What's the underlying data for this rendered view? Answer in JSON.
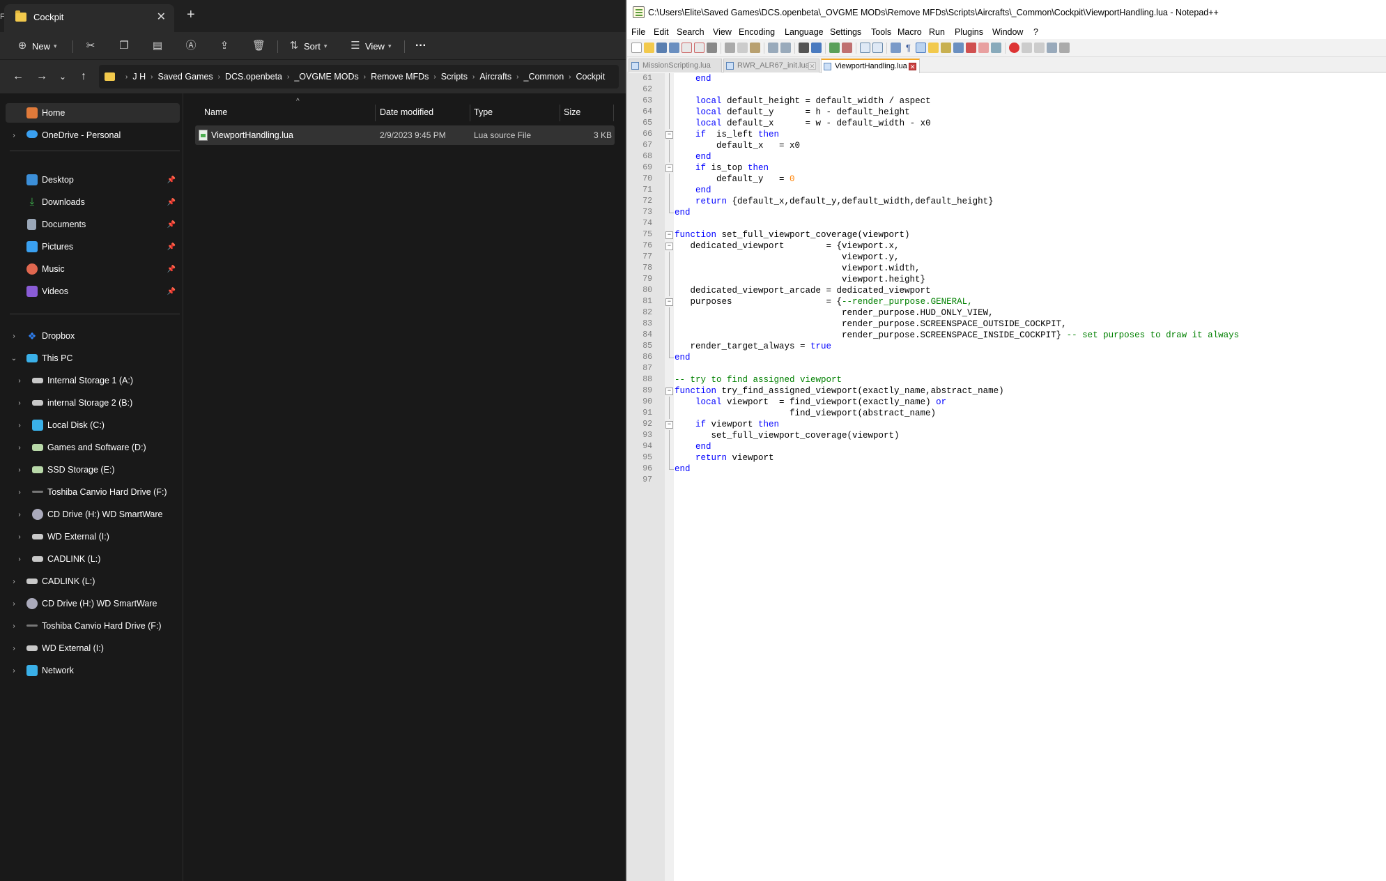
{
  "explorer": {
    "tab_title": "Cockpit",
    "edge_char": "F",
    "commands": {
      "new": "New",
      "sort": "Sort",
      "view": "View",
      "more": "···"
    },
    "breadcrumb": [
      "J H",
      "Saved Games",
      "DCS.openbeta",
      "_OVGME MODs",
      "Remove MFDs",
      "Scripts",
      "Aircrafts",
      "_Common",
      "Cockpit"
    ],
    "nav": {
      "home": "Home",
      "onedrive": "OneDrive - Personal",
      "quick_access": [
        "Desktop",
        "Downloads",
        "Documents",
        "Pictures",
        "Music",
        "Videos"
      ],
      "dropbox": "Dropbox",
      "this_pc": "This PC",
      "drives_nested": [
        "Internal Storage 1 (A:)",
        "internal Storage 2 (B:)",
        "Local Disk (C:)",
        "Games and Software (D:)",
        "SSD Storage (E:)",
        "Toshiba Canvio Hard Drive (F:)",
        "CD Drive (H:) WD SmartWare",
        "WD External  (I:)",
        "CADLINK (L:)"
      ],
      "drives_root": [
        "CADLINK (L:)",
        "CD Drive (H:) WD SmartWare",
        "Toshiba Canvio Hard Drive (F:)",
        "WD External  (I:)"
      ],
      "network": "Network"
    },
    "columns": {
      "name": "Name",
      "date": "Date modified",
      "type": "Type",
      "size": "Size"
    },
    "files": [
      {
        "name": "ViewportHandling.lua",
        "date": "2/9/2023 9:45 PM",
        "type": "Lua source File",
        "size": "3 KB"
      }
    ]
  },
  "notepad": {
    "title": "C:\\Users\\Elite\\Saved Games\\DCS.openbeta\\_OVGME MODs\\Remove MFDs\\Scripts\\Aircrafts\\_Common\\Cockpit\\ViewportHandling.lua - Notepad++",
    "menu": [
      "File",
      "Edit",
      "Search",
      "View",
      "Encoding",
      "Language",
      "Settings",
      "Tools",
      "Macro",
      "Run",
      "Plugins",
      "Window",
      "?"
    ],
    "tabs": [
      {
        "label": "MissionScripting.lua",
        "active": false
      },
      {
        "label": "RWR_ALR67_init.lua",
        "active": false
      },
      {
        "label": "ViewportHandling.lua",
        "active": true
      }
    ],
    "lines": [
      {
        "n": "61",
        "t": "    end"
      },
      {
        "n": "62",
        "t": ""
      },
      {
        "n": "63",
        "t": "    local default_height = default_width / aspect"
      },
      {
        "n": "64",
        "t": "    local default_y      = h - default_height"
      },
      {
        "n": "65",
        "t": "    local default_x      = w - default_width - x0"
      },
      {
        "n": "66",
        "t": "    if  is_left then"
      },
      {
        "n": "67",
        "t": "        default_x   = x0"
      },
      {
        "n": "68",
        "t": "    end"
      },
      {
        "n": "69",
        "t": "    if is_top then"
      },
      {
        "n": "70",
        "t": "        default_y   = 0"
      },
      {
        "n": "71",
        "t": "    end"
      },
      {
        "n": "72",
        "t": "    return {default_x,default_y,default_width,default_height}"
      },
      {
        "n": "73",
        "t": "end"
      },
      {
        "n": "74",
        "t": ""
      },
      {
        "n": "75",
        "t": "function set_full_viewport_coverage(viewport)"
      },
      {
        "n": "76",
        "t": "   dedicated_viewport        = {viewport.x,"
      },
      {
        "n": "77",
        "t": "                                viewport.y,"
      },
      {
        "n": "78",
        "t": "                                viewport.width,"
      },
      {
        "n": "79",
        "t": "                                viewport.height}"
      },
      {
        "n": "80",
        "t": "   dedicated_viewport_arcade = dedicated_viewport"
      },
      {
        "n": "81",
        "t": "   purposes                  = {--render_purpose.GENERAL,"
      },
      {
        "n": "82",
        "t": "                                render_purpose.HUD_ONLY_VIEW,"
      },
      {
        "n": "83",
        "t": "                                render_purpose.SCREENSPACE_OUTSIDE_COCKPIT,"
      },
      {
        "n": "84",
        "t": "                                render_purpose.SCREENSPACE_INSIDE_COCKPIT} -- set purposes to draw it always"
      },
      {
        "n": "85",
        "t": "   render_target_always = true"
      },
      {
        "n": "86",
        "t": "end"
      },
      {
        "n": "87",
        "t": ""
      },
      {
        "n": "88",
        "t": "-- try to find assigned viewport"
      },
      {
        "n": "89",
        "t": "function try_find_assigned_viewport(exactly_name,abstract_name)"
      },
      {
        "n": "90",
        "t": "    local viewport  = find_viewport(exactly_name) or"
      },
      {
        "n": "91",
        "t": "                      find_viewport(abstract_name)"
      },
      {
        "n": "92",
        "t": "    if viewport then"
      },
      {
        "n": "93",
        "t": "       set_full_viewport_coverage(viewport)"
      },
      {
        "n": "94",
        "t": "    end"
      },
      {
        "n": "95",
        "t": "    return viewport"
      },
      {
        "n": "96",
        "t": "end"
      },
      {
        "n": "97",
        "t": ""
      }
    ]
  }
}
